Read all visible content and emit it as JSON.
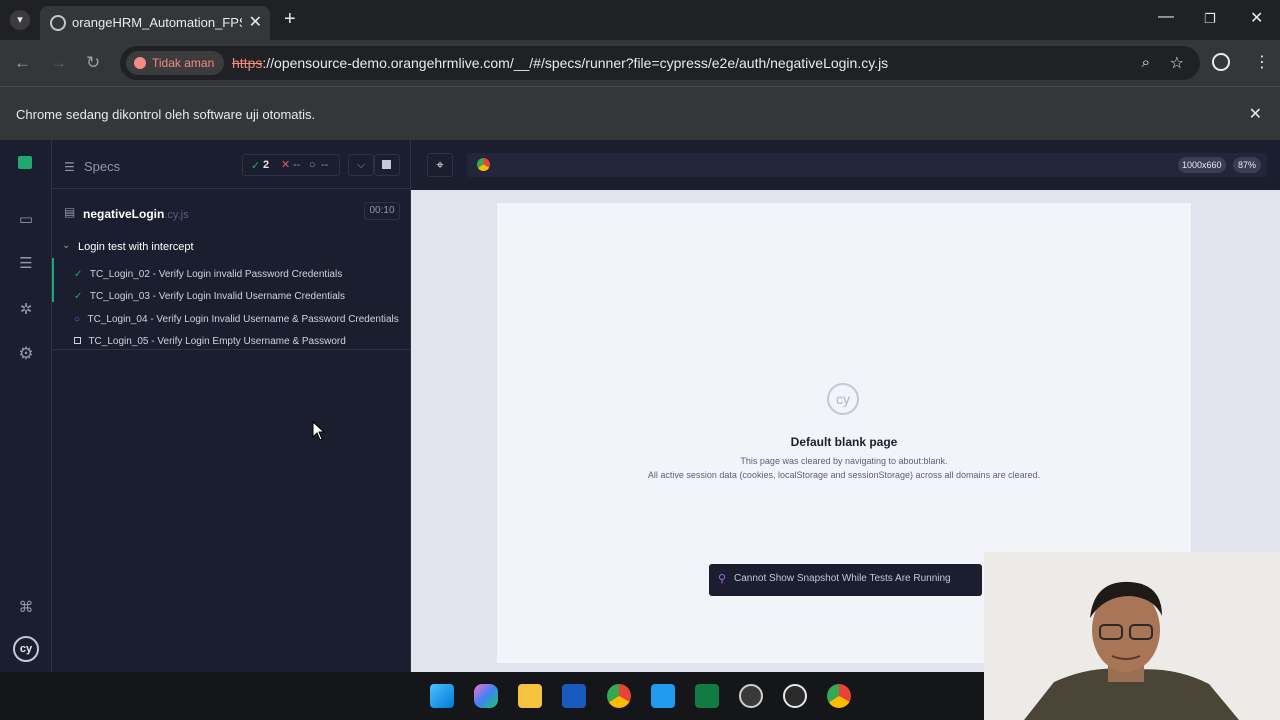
{
  "browser": {
    "tab_title": "orangeHRM_Automation_FPSanbercode",
    "tab_close": "✕",
    "new_tab": "+",
    "security_label": "Tidak aman",
    "url_scheme": "https",
    "url_rest": "://opensource-demo.orangehrmlive.com/__/#/specs/runner?file=cypress/e2e/auth/negativeLogin.cy.js",
    "infobar_text": "Chrome sedang dikontrol oleh software uji otomatis."
  },
  "runner": {
    "specs_label": "Specs",
    "passed_count": "2",
    "failed_count": "--",
    "pending_count": "--",
    "spec_name": "negativeLogin",
    "spec_ext": ".cy.js",
    "duration": "00:10",
    "suite_title": "Login test with intercept",
    "tests": [
      {
        "status": "passed",
        "title": "TC_Login_02 - Verify Login invalid Password Credentials"
      },
      {
        "status": "passed",
        "title": "TC_Login_03 - Verify Login Invalid Username Credentials"
      },
      {
        "status": "running",
        "title": "TC_Login_04 - Verify Login Invalid Username & Password Credentials"
      },
      {
        "status": "pending",
        "title": "TC_Login_05 - Verify Login Empty Username & Password"
      }
    ]
  },
  "preview": {
    "viewport": "1000x660",
    "zoom": "87%",
    "blank_title": "Default blank page",
    "blank_line1": "This page was cleared by navigating to about:blank.",
    "blank_line2": "All active session data (cookies, localStorage and sessionStorage) across all domains are cleared.",
    "snapshot_notice": "Cannot Show Snapshot While Tests Are Running"
  },
  "colors": {
    "cypress_dark": "#1b1e2e",
    "pass_green": "#1fa971",
    "fail_red": "#e45770",
    "running_indigo": "#6470f3",
    "insecure_red": "#f28b82"
  },
  "taskbar_icons": [
    "windows-start-icon",
    "copilot-icon",
    "file-explorer-icon",
    "word-icon",
    "chrome-icon",
    "vscode-icon",
    "excel-icon",
    "obs-icon",
    "cypress-icon",
    "chrome-icon"
  ]
}
